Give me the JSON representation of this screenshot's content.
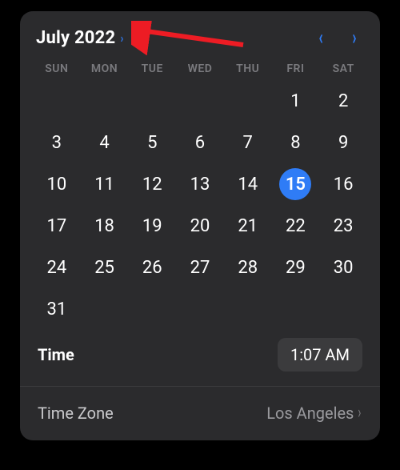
{
  "header": {
    "month_label": "July 2022"
  },
  "weekdays": [
    "SUN",
    "MON",
    "TUE",
    "WED",
    "THU",
    "FRI",
    "SAT"
  ],
  "grid": {
    "leading_blanks": 5,
    "days": [
      1,
      2,
      3,
      4,
      5,
      6,
      7,
      8,
      9,
      10,
      11,
      12,
      13,
      14,
      15,
      16,
      17,
      18,
      19,
      20,
      21,
      22,
      23,
      24,
      25,
      26,
      27,
      28,
      29,
      30,
      31
    ],
    "selected_day": 15
  },
  "time": {
    "label": "Time",
    "value": "1:07 AM"
  },
  "timezone": {
    "label": "Time Zone",
    "value": "Los Angeles"
  },
  "colors": {
    "accent": "#2f7cf6",
    "panel_bg": "#2b2b2d",
    "annotation": "#ed1c24"
  }
}
